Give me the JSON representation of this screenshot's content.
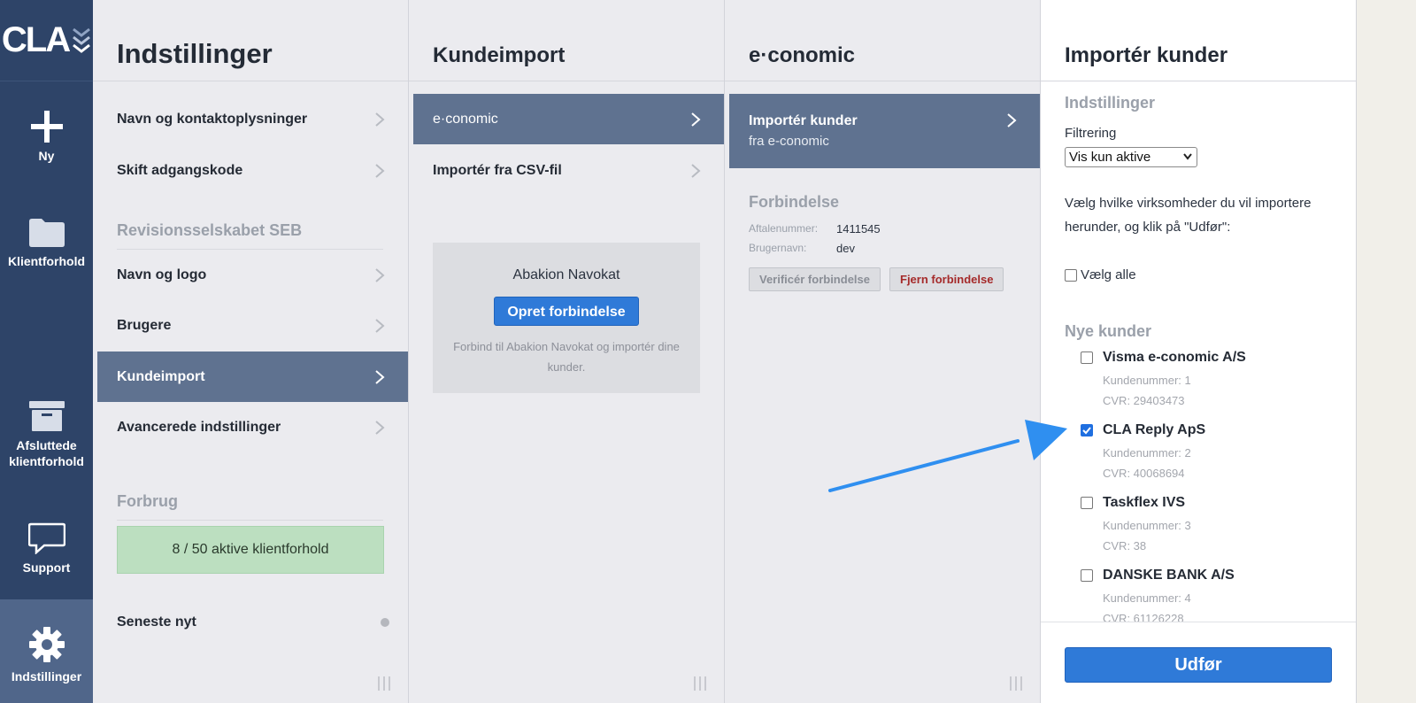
{
  "brand": {
    "logo_text": "CLA"
  },
  "rail": {
    "items": [
      {
        "label": "Ny",
        "icon": "plus-icon"
      },
      {
        "label": "Klientforhold",
        "icon": "folder-icon"
      },
      {
        "label": "Afsluttede klientforhold",
        "icon": "archive-icon"
      },
      {
        "label": "Support",
        "icon": "chat-icon"
      },
      {
        "label": "Indstillinger",
        "icon": "gear-icon",
        "active": true
      }
    ]
  },
  "settings": {
    "title": "Indstillinger",
    "items": [
      "Navn og kontaktoplysninger",
      "Skift adgangskode"
    ],
    "org_section": "Revisionsselskabet SEB",
    "org_items": [
      "Navn og logo",
      "Brugere",
      "Kundeimport",
      "Avancerede indstillinger"
    ],
    "usage_section": "Forbrug",
    "usage_text": "8 / 50 aktive klientforhold",
    "usage": {
      "used": 8,
      "limit": 50
    },
    "news": "Seneste nyt"
  },
  "customer_import": {
    "title": "Kundeimport",
    "items": [
      "e·conomic",
      "Importér fra CSV-fil"
    ],
    "box": {
      "title": "Abakion Navokat",
      "button": "Opret forbindelse",
      "desc": "Forbind til Abakion Navokat og importér dine kunder."
    }
  },
  "economic": {
    "title": "e·conomic",
    "item_title": "Importér kunder",
    "item_sub": "fra e-conomic",
    "connection_title": "Forbindelse",
    "agreement_label": "Aftalenummer:",
    "agreement_value": "1411545",
    "user_label": "Brugernavn:",
    "user_value": "dev",
    "verify_button": "Verificér forbindelse",
    "remove_button": "Fjern forbindelse"
  },
  "import": {
    "title": "Importér kunder",
    "settings_section": "Indstillinger",
    "filter_label": "Filtrering",
    "filter_value": "Vis kun aktive",
    "description": "Vælg hvilke virksomheder du vil importere herunder, og klik på \"Udfør\":",
    "select_all": "Vælg alle",
    "new_section": "Nye kunder",
    "customers": [
      {
        "name": "Visma e-conomic A/S",
        "number": "Kundenummer: 1",
        "cvr": "CVR: 29403473",
        "checked": false
      },
      {
        "name": "CLA Reply ApS",
        "number": "Kundenummer: 2",
        "cvr": "CVR: 40068694",
        "checked": true
      },
      {
        "name": "Taskflex IVS",
        "number": "Kundenummer: 3",
        "cvr": "CVR: 38",
        "checked": false
      },
      {
        "name": "DANSKE BANK A/S",
        "number": "Kundenummer: 4",
        "cvr": "CVR: 61126228",
        "checked": false
      }
    ],
    "submit": "Udfør"
  },
  "colors": {
    "rail": "#2e4468",
    "active_row": "#5f7290",
    "primary_button": "#2f7ad8",
    "usage_bg": "#bcdfc0",
    "annotation_arrow": "#2f8ff0"
  }
}
